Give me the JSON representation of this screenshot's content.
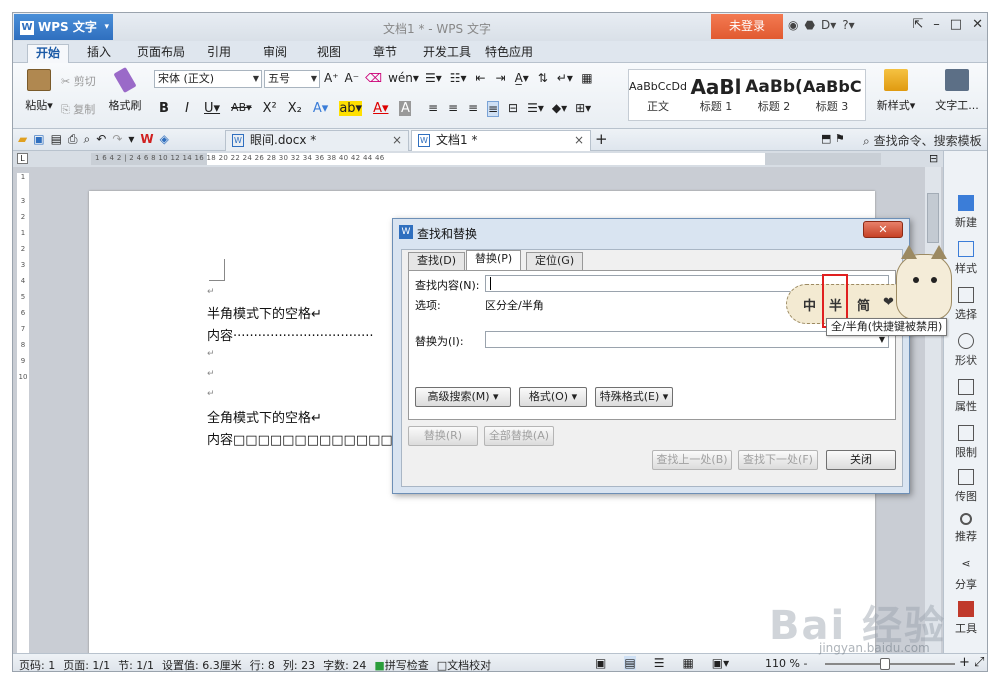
{
  "app": {
    "menu_label": "WPS 文字",
    "window_title": "文档1 * - WPS 文字",
    "login_label": "未登录"
  },
  "menu_tabs": [
    "开始",
    "插入",
    "页面布局",
    "引用",
    "审阅",
    "视图",
    "章节",
    "开发工具",
    "特色应用"
  ],
  "ribbon": {
    "paste": "粘贴",
    "cut": "剪切",
    "copy": "复制",
    "format_painter": "格式刷",
    "font_name": "宋体 (正文)",
    "font_size": "五号",
    "styles": [
      {
        "sample": "AaBbCcDd",
        "name": "正文"
      },
      {
        "sample": "AaBl",
        "name": "标题 1"
      },
      {
        "sample": "AaBb(",
        "name": "标题 2"
      },
      {
        "sample": "AaBbC",
        "name": "标题 3"
      }
    ],
    "new_style": "新样式",
    "text_tools": "文字工..."
  },
  "doc_tabs": [
    {
      "label": "眼间.docx *",
      "active": false
    },
    {
      "label": "文档1 *",
      "active": true
    }
  ],
  "search_placeholder": "查找命令、搜索模板",
  "ruler_text": "1  6  4  2  |  2  4  6  8  10  12  14  16  18  20  22  24  26  28  30  32  34  36  38  40  42  44  46",
  "document": {
    "lines": [
      {
        "text": "↵",
        "para": true
      },
      {
        "text": "半角模式下的空格↵",
        "para": false
      },
      {
        "text": "内容··································",
        "para": false
      },
      {
        "text": "↵",
        "para": true
      },
      {
        "text": "↵",
        "para": true
      },
      {
        "text": "↵",
        "para": true
      },
      {
        "text": "全角模式下的空格↵",
        "para": false
      },
      {
        "text": "内容□□□□□□□□□□□□□",
        "para": false
      }
    ]
  },
  "taskpane": [
    "新建",
    "样式",
    "选择",
    "形状",
    "属性",
    "限制",
    "传图",
    "推荐",
    "分享",
    "工具"
  ],
  "status": {
    "items": [
      "页码: 1",
      "页面: 1/1",
      "节: 1/1",
      "设置值: 6.3厘米",
      "行: 8",
      "列: 23",
      "字数: 24",
      "拼写检查",
      "文档校对"
    ],
    "zoom": "110 % -"
  },
  "dialog": {
    "title": "查找和替换",
    "tabs": [
      "查找(D)",
      "替换(P)",
      "定位(G)"
    ],
    "find_label": "查找内容(N):",
    "find_value": "",
    "options_label": "选项:",
    "options_value": "区分全/半角",
    "replace_label": "替换为(I):",
    "replace_value": "",
    "advanced": "高级搜索(M) ▾",
    "format": "格式(O) ▾",
    "special": "特殊格式(E) ▾",
    "replace_btn": "替换(R)",
    "replace_all_btn": "全部替换(A)",
    "find_prev_btn": "查找上一处(B)",
    "find_next_btn": "查找下一处(F)",
    "close_btn": "关闭"
  },
  "ime": {
    "items": [
      "中",
      "半",
      "简",
      "❤"
    ],
    "tooltip": "全/半角(快捷键被禁用)"
  },
  "watermark": {
    "main": "Bai 经验",
    "sub": "jingyan.baidu.com"
  }
}
